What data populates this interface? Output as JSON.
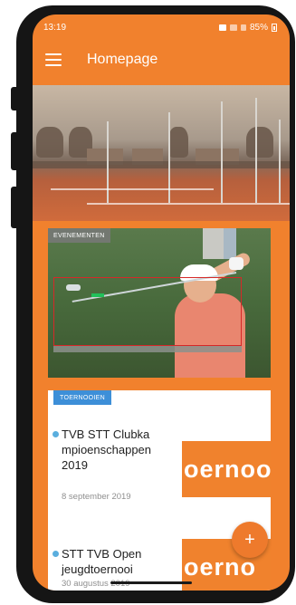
{
  "status_bar": {
    "time": "13:19",
    "battery": "85%"
  },
  "app_bar": {
    "title": "Homepage",
    "menu_icon": "hamburger-menu-icon"
  },
  "events_card": {
    "tag": "EVENEMENTEN"
  },
  "tournaments_card": {
    "tag": "TOERNOOIEN",
    "items": [
      {
        "title": "TVB STT Clubka mpioenschappen 2019",
        "date": "8 september 2019",
        "thumb_text": "oernoo"
      },
      {
        "title": "STT TVB Open jeugdtoernooi",
        "date": "30 augustus 2019",
        "thumb_text": "oerno"
      }
    ]
  },
  "fab": {
    "label": "+",
    "icon": "plus-icon"
  },
  "colors": {
    "primary": "#f1812d",
    "tag_blue": "#3d8fd8",
    "dot_blue": "#5aaede"
  }
}
